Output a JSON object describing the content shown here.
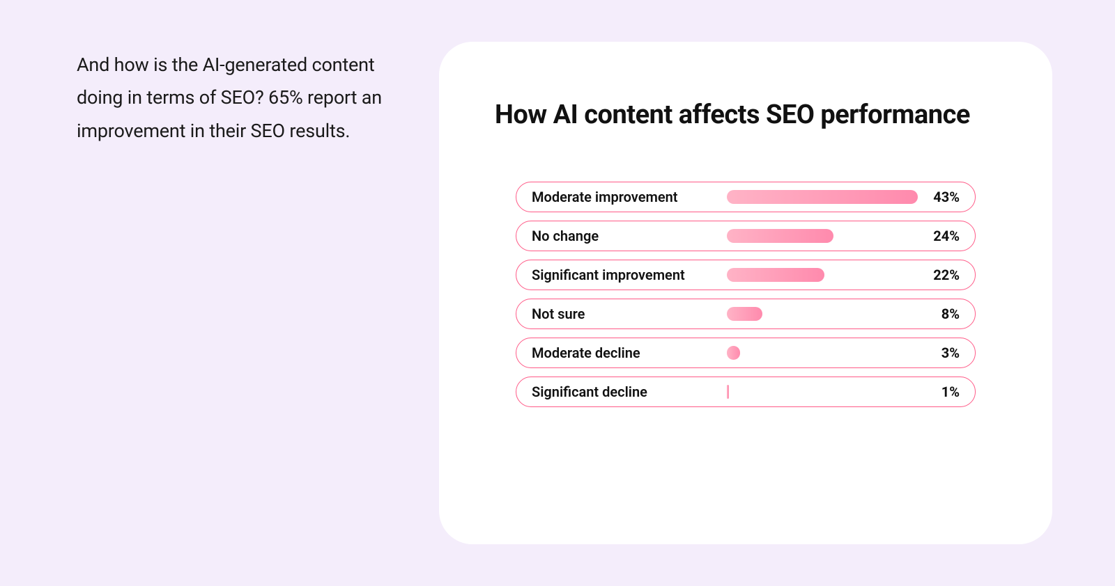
{
  "intro": "And how is the AI-generated content doing in terms of SEO? 65% report an improvement in their SEO results.",
  "chart_data": {
    "type": "bar",
    "title": "How AI content affects SEO performance",
    "categories": [
      "Moderate improvement",
      "No change",
      "Significant improvement",
      "Not sure",
      "Moderate decline",
      "Significant decline"
    ],
    "values": [
      43,
      24,
      22,
      8,
      3,
      1
    ],
    "value_suffix": "%",
    "max_value": 43
  },
  "colors": {
    "background": "#f4edfb",
    "card": "#ffffff",
    "bar_border": "#ff5a87",
    "bar_fill_start": "#ffb3c6",
    "bar_fill_end": "#ff8aad"
  }
}
